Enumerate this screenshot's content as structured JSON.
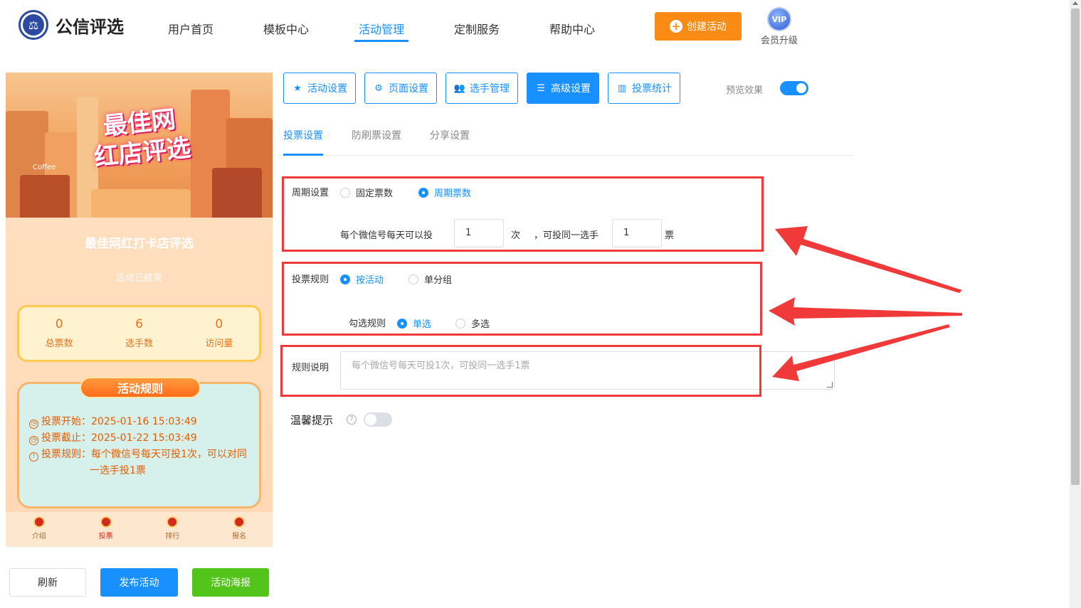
{
  "header": {
    "logo_text": "公信评选",
    "nav": [
      "用户首页",
      "模板中心",
      "活动管理",
      "定制服务",
      "帮助中心"
    ],
    "active_nav": "活动管理",
    "create_button": "创建活动",
    "vip_badge": "VIP",
    "vip_label": "会员升级"
  },
  "preview": {
    "banner_title_line1": "最佳网",
    "banner_title_line2": "红店评选",
    "banner_shop_sign": "Coffee",
    "activity_name": "最佳网红打卡店评选",
    "activity_status": "活动已结束",
    "stats": [
      {
        "value": "0",
        "label": "总票数"
      },
      {
        "value": "6",
        "label": "选手数"
      },
      {
        "value": "0",
        "label": "访问量"
      }
    ],
    "rules_title": "活动规则",
    "rules": {
      "start": "投票开始：2025-01-16 15:03:49",
      "end": "投票截止：2025-01-22 15:03:49",
      "rule_line1": "投票规则：每个微信号每天可投1次，可以对同",
      "rule_line2": "一选手投1票"
    },
    "tabs": [
      "介绍",
      "投票",
      "排行",
      "报名"
    ],
    "active_tab": "投票"
  },
  "actions": {
    "refresh": "刷新",
    "publish": "发布活动",
    "poster": "活动海报"
  },
  "toolbar": {
    "buttons": [
      "活动设置",
      "页面设置",
      "选手管理",
      "高级设置",
      "投票统计"
    ],
    "active": "高级设置",
    "preview_label": "预览效果",
    "preview_on": true
  },
  "subtabs": [
    "投票设置",
    "防刷票设置",
    "分享设置"
  ],
  "period": {
    "label": "周期设置",
    "option_fixed": "固定票数",
    "option_cycle": "周期票数",
    "selected": "周期票数",
    "text1": "每个微信号每天可以投",
    "times_value": "1",
    "text2": "次",
    "text3": "，可投同一选手",
    "votes_value": "1",
    "text4": "票"
  },
  "vote_rule": {
    "label": "投票规则",
    "option_activity": "按活动",
    "option_group": "单分组",
    "selected": "按活动",
    "check_label": "勾选规则",
    "option_single": "单选",
    "option_multi": "多选",
    "check_selected": "单选"
  },
  "rule_desc": {
    "label": "规则说明",
    "placeholder": "每个微信号每天可投1次，可投同一选手1票"
  },
  "tip": {
    "label": "温馨提示",
    "enabled": false
  },
  "colors": {
    "accent": "#1890ff",
    "orange": "#fa8c16",
    "green": "#52c41a",
    "highlight": "#f03a3a"
  }
}
